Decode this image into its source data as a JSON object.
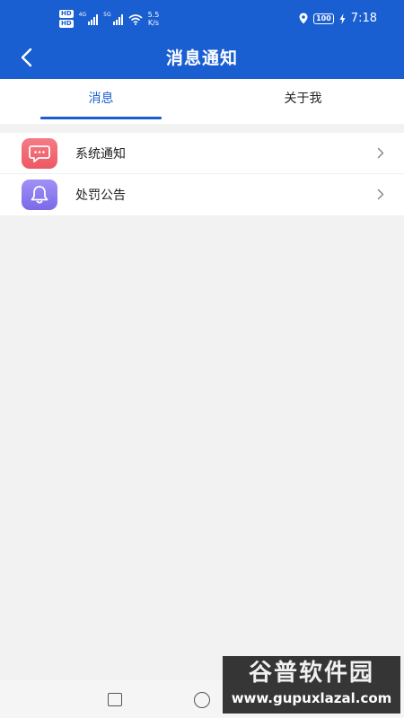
{
  "colors": {
    "primary": "#1a5fd1",
    "background": "#f2f2f2",
    "surface": "#ffffff",
    "notification_icon_bg": "#f06a72",
    "bell_icon_bg": "#8f7ff0"
  },
  "status_bar": {
    "hd1": "HD",
    "hd2": "HD",
    "sim1_type": "4G",
    "sim2_type": "5G",
    "net_speed_value": "5.5",
    "net_speed_unit": "K/s",
    "battery": "100",
    "time": "7:18"
  },
  "header": {
    "title": "消息通知",
    "back_icon": "chevron-left-icon"
  },
  "tabs": [
    {
      "label": "消息",
      "active": true
    },
    {
      "label": "关于我",
      "active": false
    }
  ],
  "list": [
    {
      "label": "系统通知",
      "icon": "chat-bubble-icon"
    },
    {
      "label": "处罚公告",
      "icon": "bell-icon"
    }
  ],
  "system_nav": {
    "square": "recent-apps-icon",
    "circle": "home-icon"
  },
  "watermark": {
    "title": "谷普软件园",
    "url": "www.gupuxlazal.com"
  }
}
